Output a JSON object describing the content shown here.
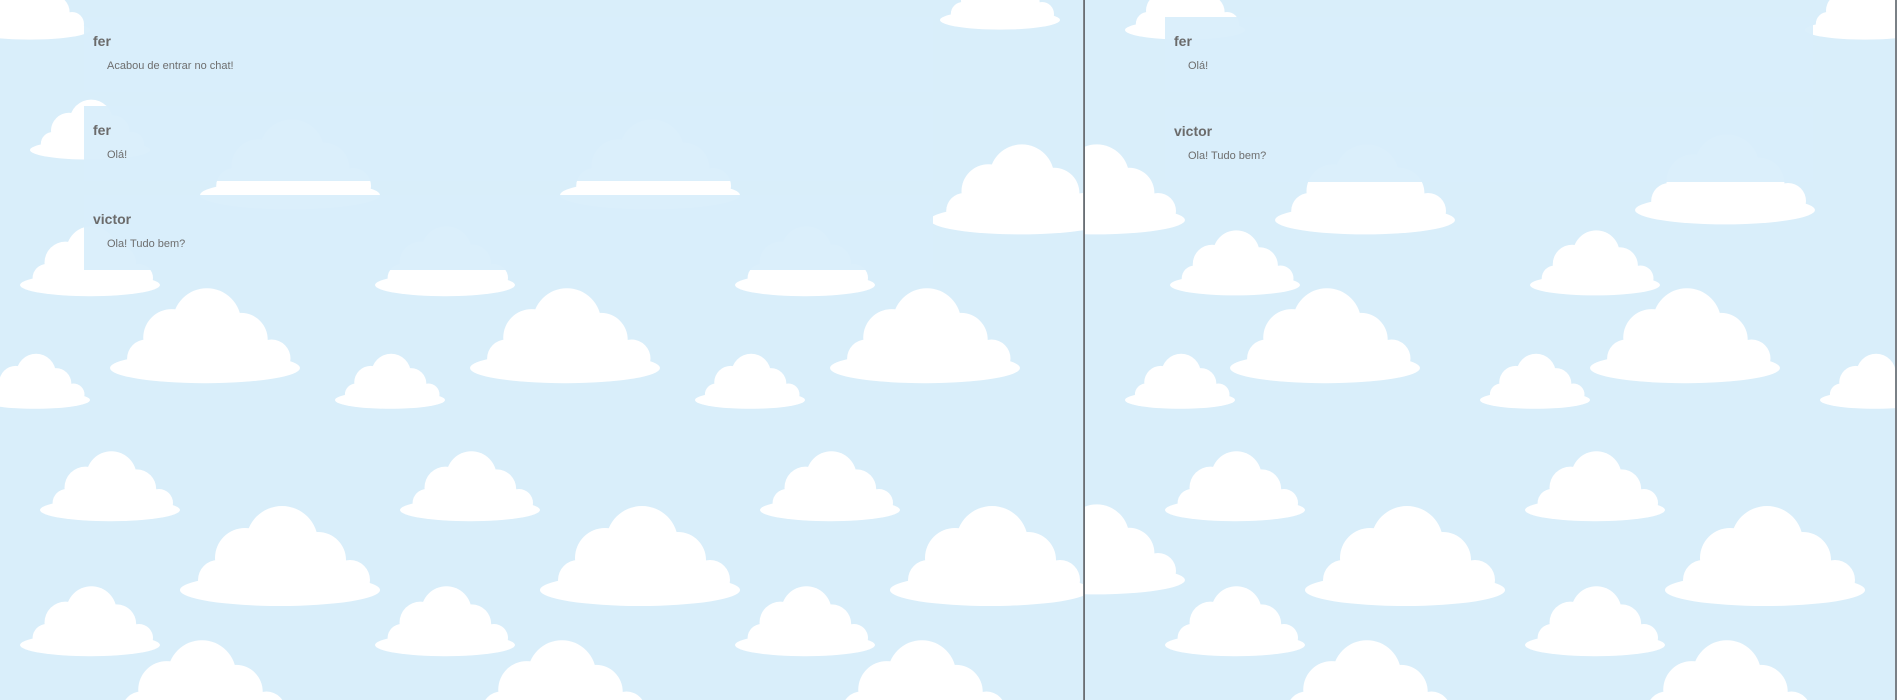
{
  "left_window": {
    "messages": [
      {
        "author": "fer",
        "text": "Acabou de entrar no chat!"
      },
      {
        "author": "fer",
        "text": "Olá!"
      },
      {
        "author": "victor",
        "text": "Ola! Tudo bem?"
      }
    ]
  },
  "right_window": {
    "messages": [
      {
        "author": "fer",
        "text": "Olá!"
      },
      {
        "author": "victor",
        "text": "Ola! Tudo bem?"
      }
    ]
  },
  "colors": {
    "sky": "#d9eefa",
    "message_bg": "#d8eefb",
    "cloud": "#ffffff",
    "author": "#6b6b6b",
    "text": "#6e6e6e"
  }
}
